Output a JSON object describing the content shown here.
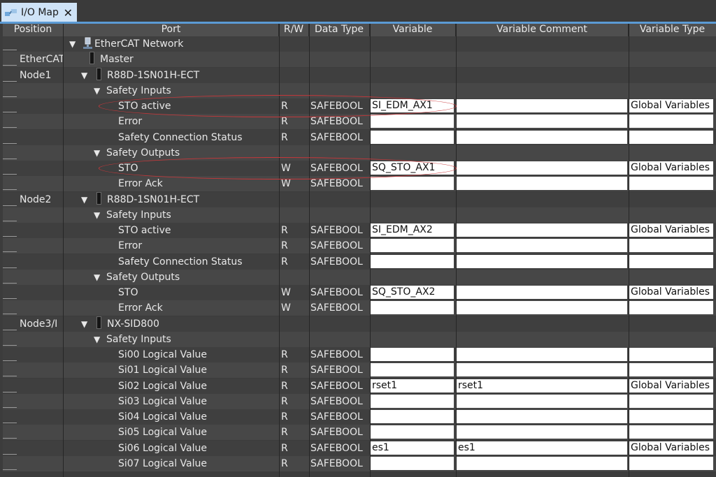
{
  "tab": {
    "title": "I/O Map",
    "close_glyph": "✕",
    "icon": "io-map-icon"
  },
  "columns": {
    "position": "Position",
    "port": "Port",
    "rw": "R/W",
    "data_type": "Data Type",
    "variable": "Variable",
    "variable_comment": "Variable Comment",
    "variable_type": "Variable Type"
  },
  "rows": [
    {
      "type": "network",
      "position": "",
      "port": "EtherCAT Network"
    },
    {
      "type": "device",
      "position": "EtherCAT",
      "port": "Master"
    },
    {
      "type": "node",
      "position": "Node1",
      "port": "R88D-1SN01H-ECT"
    },
    {
      "type": "group",
      "position": "",
      "port": "Safety Inputs"
    },
    {
      "type": "io",
      "position": "",
      "port": "STO active",
      "rw": "R",
      "data_type": "SAFEBOOL",
      "variable": "SI_EDM_AX1",
      "comment": "",
      "var_type": "Global Variables"
    },
    {
      "type": "io",
      "position": "",
      "port": "Error",
      "rw": "R",
      "data_type": "SAFEBOOL",
      "variable": "",
      "comment": "",
      "var_type": ""
    },
    {
      "type": "io",
      "position": "",
      "port": "Safety Connection Status",
      "rw": "R",
      "data_type": "SAFEBOOL",
      "variable": "",
      "comment": "",
      "var_type": ""
    },
    {
      "type": "group",
      "position": "",
      "port": "Safety Outputs"
    },
    {
      "type": "io",
      "position": "",
      "port": "STO",
      "rw": "W",
      "data_type": "SAFEBOOL",
      "variable": "SQ_STO_AX1",
      "comment": "",
      "var_type": "Global Variables"
    },
    {
      "type": "io",
      "position": "",
      "port": "Error Ack",
      "rw": "W",
      "data_type": "SAFEBOOL",
      "variable": "",
      "comment": "",
      "var_type": ""
    },
    {
      "type": "node",
      "position": "Node2",
      "port": "R88D-1SN01H-ECT"
    },
    {
      "type": "group",
      "position": "",
      "port": "Safety Inputs"
    },
    {
      "type": "io",
      "position": "",
      "port": "STO active",
      "rw": "R",
      "data_type": "SAFEBOOL",
      "variable": "SI_EDM_AX2",
      "comment": "",
      "var_type": "Global Variables"
    },
    {
      "type": "io",
      "position": "",
      "port": "Error",
      "rw": "R",
      "data_type": "SAFEBOOL",
      "variable": "",
      "comment": "",
      "var_type": ""
    },
    {
      "type": "io",
      "position": "",
      "port": "Safety Connection Status",
      "rw": "R",
      "data_type": "SAFEBOOL",
      "variable": "",
      "comment": "",
      "var_type": ""
    },
    {
      "type": "group",
      "position": "",
      "port": "Safety Outputs"
    },
    {
      "type": "io",
      "position": "",
      "port": "STO",
      "rw": "W",
      "data_type": "SAFEBOOL",
      "variable": "SQ_STO_AX2",
      "comment": "",
      "var_type": "Global Variables"
    },
    {
      "type": "io",
      "position": "",
      "port": "Error Ack",
      "rw": "W",
      "data_type": "SAFEBOOL",
      "variable": "",
      "comment": "",
      "var_type": ""
    },
    {
      "type": "node",
      "position": "Node3/I",
      "port": "NX-SID800"
    },
    {
      "type": "group",
      "position": "",
      "port": "Safety Inputs"
    },
    {
      "type": "io",
      "position": "",
      "port": "Si00 Logical Value",
      "rw": "R",
      "data_type": "SAFEBOOL",
      "variable": "",
      "comment": "",
      "var_type": ""
    },
    {
      "type": "io",
      "position": "",
      "port": "Si01 Logical Value",
      "rw": "R",
      "data_type": "SAFEBOOL",
      "variable": "",
      "comment": "",
      "var_type": ""
    },
    {
      "type": "io",
      "position": "",
      "port": "Si02 Logical Value",
      "rw": "R",
      "data_type": "SAFEBOOL",
      "variable": "rset1",
      "comment": "rset1",
      "var_type": "Global Variables"
    },
    {
      "type": "io",
      "position": "",
      "port": "Si03 Logical Value",
      "rw": "R",
      "data_type": "SAFEBOOL",
      "variable": "",
      "comment": "",
      "var_type": ""
    },
    {
      "type": "io",
      "position": "",
      "port": "Si04 Logical Value",
      "rw": "R",
      "data_type": "SAFEBOOL",
      "variable": "",
      "comment": "",
      "var_type": ""
    },
    {
      "type": "io",
      "position": "",
      "port": "Si05 Logical Value",
      "rw": "R",
      "data_type": "SAFEBOOL",
      "variable": "",
      "comment": "",
      "var_type": ""
    },
    {
      "type": "io",
      "position": "",
      "port": "Si06 Logical Value",
      "rw": "R",
      "data_type": "SAFEBOOL",
      "variable": "es1",
      "comment": "es1",
      "var_type": "Global Variables"
    },
    {
      "type": "io",
      "position": "",
      "port": "Si07 Logical Value",
      "rw": "R",
      "data_type": "SAFEBOOL",
      "variable": "",
      "comment": "",
      "var_type": ""
    }
  ],
  "highlights": [
    {
      "row": 4,
      "label": "STO active mapping highlight"
    },
    {
      "row": 8,
      "label": "STO mapping highlight"
    }
  ],
  "colors": {
    "accent": "#5b9bd5",
    "highlight": "#c8373a",
    "tab_bg": "#cfe3f7"
  }
}
